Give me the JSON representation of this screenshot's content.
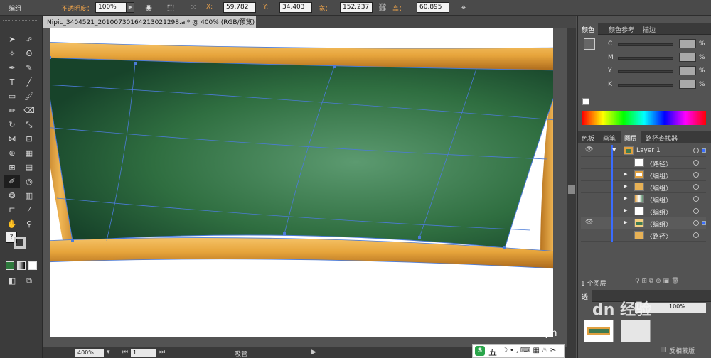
{
  "control_bar": {
    "selection_label": "编组",
    "opacity_label": "不透明度：",
    "opacity_value": "100%",
    "x_label": "X:",
    "x_value": "59.782",
    "y_label": "Y:",
    "y_value": "34.403",
    "w_label": "宽：",
    "w_value": "152.237",
    "h_label": "高：",
    "h_value": "60.895",
    "value_unit": "",
    "icons": [
      "globe-icon",
      "transform-icon",
      "reference-point-icon",
      "link-icon",
      "align-icon"
    ]
  },
  "document": {
    "tab_title": "Nipic_3404521_20100730164213021298.ai* @ 400% (RGB/预览)",
    "close_label": "×"
  },
  "status_bar": {
    "zoom": "400%",
    "page": "1",
    "mode": "吸管"
  },
  "color_panel": {
    "tabs": [
      "颜色",
      "颜色参考",
      "描边"
    ],
    "active_tab": 0,
    "channels": [
      {
        "label": "C",
        "unit": "%"
      },
      {
        "label": "M",
        "unit": "%"
      },
      {
        "label": "Y",
        "unit": "%"
      },
      {
        "label": "K",
        "unit": "%"
      }
    ]
  },
  "layers_panel": {
    "tabs": [
      "色板",
      "画笔",
      "图层",
      "路径查找器"
    ],
    "active_tab": 2,
    "rows": [
      {
        "name": "Layer 1",
        "eye": true,
        "triangle": "▼",
        "thumb": "layer",
        "selected": false
      },
      {
        "name": "〈路径〉",
        "eye": false,
        "triangle": "",
        "thumb": "white",
        "selected": false
      },
      {
        "name": "〈编组〉",
        "eye": false,
        "triangle": "▶",
        "thumb": "frame",
        "selected": false
      },
      {
        "name": "〈编组〉",
        "eye": false,
        "triangle": "▶",
        "thumb": "orange",
        "selected": false
      },
      {
        "name": "〈编组〉",
        "eye": false,
        "triangle": "▶",
        "thumb": "mixed",
        "selected": false
      },
      {
        "name": "〈编组〉",
        "eye": false,
        "triangle": "▶",
        "thumb": "white",
        "selected": false
      },
      {
        "name": "〈编组〉",
        "eye": true,
        "triangle": "▶",
        "thumb": "board",
        "selected": true
      },
      {
        "name": "〈路径〉",
        "eye": false,
        "triangle": "",
        "thumb": "orange",
        "selected": false
      }
    ],
    "footer": "1 个图层"
  },
  "transparency_panel": {
    "tab": "透",
    "opacity": "100%",
    "invert_mask_label": "反相蒙版"
  },
  "watermark": {
    "text": "dn 经验",
    "sub": "jin"
  },
  "taskbar": {
    "ime_label": "五"
  },
  "colors": {
    "board_green": "#3f7a50",
    "frame_orange": "#e0a040",
    "ui_dark": "#3b3b3b",
    "path_blue": "#4b7bd8"
  }
}
